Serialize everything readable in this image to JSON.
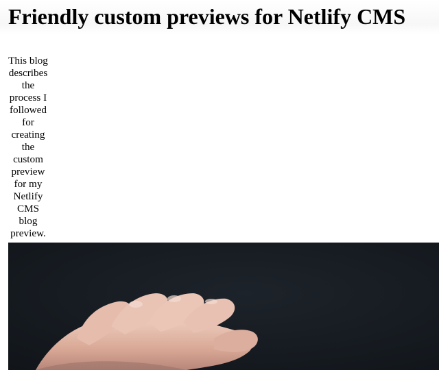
{
  "article": {
    "title": "Friendly custom previews for Netlify CMS",
    "description": "This blog describes the process I followed for creating the custom preview for my Netlify CMS blog preview."
  },
  "hero_image": {
    "subject": "hand-on-dark-background",
    "background_color": "#161b20",
    "skin_color": "#e8c2b3"
  }
}
